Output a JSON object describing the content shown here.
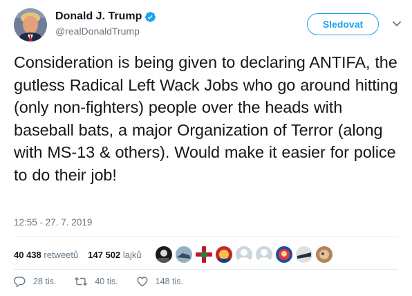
{
  "author": {
    "name": "Donald J. Trump",
    "handle": "@realDonaldTrump",
    "verified": true
  },
  "follow_button": {
    "label": "Sledovat"
  },
  "tweet": {
    "text": "Consideration is being given to declaring ANTIFA, the gutless Radical Left Wack Jobs who go around hitting (only non-fighters) people over the heads with baseball bats, a major Organization of Terror (along with MS-13 & others). Would make it easier for police to do their job!",
    "timestamp": "12:55 - 27. 7. 2019"
  },
  "stats": {
    "retweets_count": "40 438",
    "retweets_label": "retweetů",
    "likes_count": "147 502",
    "likes_label": "lajků"
  },
  "actions": {
    "reply_count": "28 tis.",
    "retweet_count": "40 tis.",
    "like_count": "148 tis."
  },
  "colors": {
    "accent": "#1da1f2",
    "secondary_text": "#657786",
    "divider": "#e6ecf0"
  },
  "icons": [
    "verified-badge-icon",
    "chevron-down-icon",
    "reply-icon",
    "retweet-icon",
    "heart-icon"
  ]
}
